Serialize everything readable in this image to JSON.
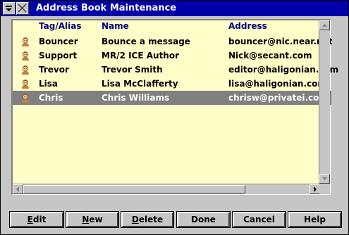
{
  "window": {
    "title": "Address Book Maintenance",
    "title_bar_color": "#0000aa",
    "list_background": "#fffdc8",
    "header_color": "#000080",
    "selection_color": "#808080"
  },
  "list": {
    "columns": [
      "Tag/Alias",
      "Name",
      "Address"
    ],
    "rows": [
      {
        "tag": "Bouncer",
        "name": "Bounce a message",
        "address": "bouncer@nic.near.net",
        "icon": "person-icon",
        "selected": false
      },
      {
        "tag": "Support",
        "name": "MR/2 ICE Author",
        "address": "Nick@secant.com",
        "icon": "person-icon",
        "selected": false
      },
      {
        "tag": "Trevor",
        "name": "Trevor Smith",
        "address": "editor@haligonian.com",
        "icon": "person-icon",
        "selected": false
      },
      {
        "tag": "Lisa",
        "name": "Lisa McClafferty",
        "address": "lisa@haligonian.com",
        "icon": "person-icon",
        "selected": false
      },
      {
        "tag": "Chris",
        "name": "Chris Williams",
        "address": "chrisw@privatei.com",
        "icon": "person-icon",
        "selected": true
      }
    ]
  },
  "buttons": {
    "edit": {
      "first": "E",
      "rest": "dit"
    },
    "new": {
      "first": "N",
      "rest": "ew"
    },
    "delete": {
      "first": "D",
      "rest": "elete"
    },
    "done": {
      "first": "D",
      "rest": "one"
    },
    "cancel": {
      "label": "Cancel"
    },
    "help": {
      "label": "Help"
    }
  }
}
